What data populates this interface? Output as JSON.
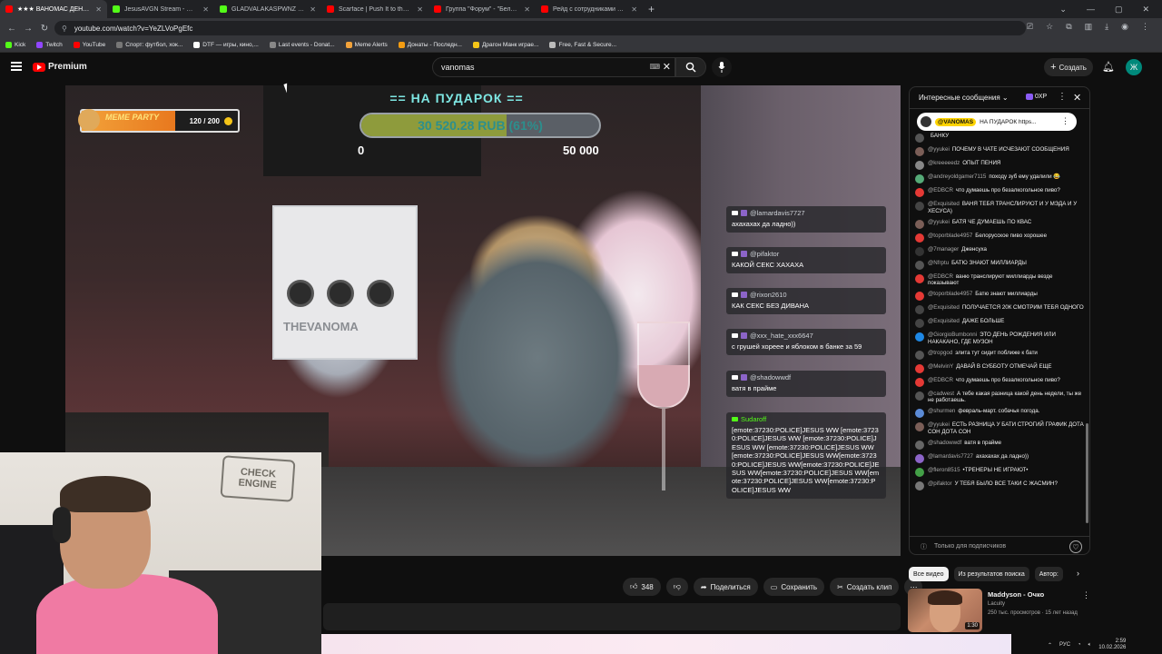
{
  "tabs": [
    {
      "title": "★★★ ВАНОМАС ДЕНЬ РОЖДЕНИЯ",
      "color": "#ff0000",
      "active": true
    },
    {
      "title": "JesusAVGN Stream - Watch Live",
      "color": "#53fc18"
    },
    {
      "title": "GLADVALAKASPWNZ Stream - Watch",
      "color": "#53fc18"
    },
    {
      "title": "Scarface | Push It to the Limit",
      "color": "#ff0000"
    },
    {
      "title": "Группа \"Форум\" - \"Белая ночь\"",
      "color": "#ff0000"
    },
    {
      "title": "Рейд с сотрудниками ППСП",
      "color": "#ff0000"
    }
  ],
  "browser": {
    "url": "youtube.com/watch?v=YeZLVoPgEfc"
  },
  "bookmarks": [
    {
      "label": "Kick",
      "color": "#53fc18"
    },
    {
      "label": "Twitch",
      "color": "#9146ff"
    },
    {
      "label": "YouTube",
      "color": "#ff0000"
    },
    {
      "label": "Спорт: футбол, хок...",
      "color": "#777"
    },
    {
      "label": "DTF — игры, кино,...",
      "color": "#ffffff"
    },
    {
      "label": "Last events - Donat...",
      "color": "#888"
    },
    {
      "label": "Meme Alerts",
      "color": "#f2a23a"
    },
    {
      "label": "Донаты - Последн...",
      "color": "#f39c12"
    },
    {
      "label": "Драгон Манк играе...",
      "color": "#f5c518"
    },
    {
      "label": "Free, Fast & Secure...",
      "color": "#bbb"
    }
  ],
  "yt": {
    "logo": "Premium",
    "search_value": "vanomas",
    "create_label": "Создать",
    "avatar_letter": "Ж"
  },
  "overlay": {
    "goal_title": "== НА ПУДАРОК ==",
    "goal_amount": "30 520.28 RUB (61%)",
    "goal_progress": 0.61,
    "goal_min": "0",
    "goal_max": "50 000",
    "meme_label": "MEME PARTY",
    "meme_count": "120 / 200",
    "meme_progress": 0.6
  },
  "overlay_chat": [
    {
      "user": "@lamardavis7727",
      "msg": "ахахахах да ладно))"
    },
    {
      "user": "@pifaktor",
      "msg": "КАКОЙ СЕКС ХАХАХА"
    },
    {
      "user": "@rixon2610",
      "msg": "КАК СЕКС БЕЗ ДИВАНА"
    },
    {
      "user": "@xxx_hate_xxx6647",
      "msg": "с грушей хорееe и яблоком в банке за 59"
    },
    {
      "user": "@shadowwdf",
      "msg": "ватя в прайме"
    },
    {
      "user": "Sudaroff",
      "msg": "[emote:37230:POLICE]JESUS WW [emote:37230:POLICE]JESUS WW [emote:37230:POLICE]JESUS WW [emote:37230:POLICE]JESUS WW [emote:37230:POLICE]JESUS WW[emote:37230:POLICE]JESUS WW[emote:37230:POLICE]JESUS WW[emote:37230:POLICE]JESUS WW[emote:37230:POLICE]JESUS WW[emote:37230:POLICE]JESUS WW"
    }
  ],
  "webcam": {
    "sign": "CHECK ENGINE"
  },
  "actions": {
    "likes": "348",
    "share": "Поделиться",
    "save": "Сохранить",
    "clip": "Создать клип"
  },
  "chat": {
    "title": "Интересные сообщения",
    "xp": "0XP",
    "pinned_user": "@VANOMAS",
    "pinned_text": "НА ПУДАРОК https...",
    "footer": "Только для подписчиков",
    "messages": [
      {
        "user": "",
        "text": "БАНКУ",
        "color": "#555"
      },
      {
        "user": "@yyukei",
        "text": "ПОЧЕМУ В ЧАТЕ ИСЧЕЗАЮТ СООБЩЕНИЯ",
        "color": "#7b5e57"
      },
      {
        "user": "@kreeeeedz",
        "text": "ОПЫТ ПЕНИЯ",
        "color": "#888"
      },
      {
        "user": "@andreyoldgamer7115",
        "text": "походу зуб ему удалили 😂",
        "color": "#5a7"
      },
      {
        "user": "@EDBCR",
        "text": "что думаешь про безалкогольное пиво?",
        "color": "#e53935"
      },
      {
        "user": "@Exquisited",
        "text": "ВАНЯ ТЕБЯ ТРАНСЛИРУЮТ И У МЭДА И У ХЕСУСА)",
        "color": "#444"
      },
      {
        "user": "@yyukei",
        "text": "БАТЯ ЧЕ ДУМАЕШЬ ПО КВАС",
        "color": "#7b5e57"
      },
      {
        "user": "@toporblade4957",
        "text": "Белорусское пиво хорошее",
        "color": "#e53935"
      },
      {
        "user": "@7manager",
        "text": "Дженсуха",
        "color": "#333"
      },
      {
        "user": "@Nfrptu",
        "text": "БАТЮ ЗНАЮТ МИЛЛИАРДЫ",
        "color": "#555"
      },
      {
        "user": "@EDBCR",
        "text": "ваню транслируют миллиарды везде показывают",
        "color": "#e53935"
      },
      {
        "user": "@toporblade4957",
        "text": "Батю знают миллиарды",
        "color": "#e53935"
      },
      {
        "user": "@Exquisited",
        "text": "ПОЛУЧАЕТСЯ 20К СМОТРИМ ТЕБЯ ОДНОГО",
        "color": "#444"
      },
      {
        "user": "@Exquisited",
        "text": "ДАЖЕ БОЛЬШЕ",
        "color": "#444"
      },
      {
        "user": "@GiorgioBumbonni",
        "text": "ЭТО ДЕНЬ РОЖДЕНИЯ ИЛИ НАКАКАНО, ГДЕ МУЗОН",
        "color": "#1e88e5"
      },
      {
        "user": "@tropgod",
        "text": "элита тут сидит поближе к бати",
        "color": "#555"
      },
      {
        "user": "@MelvinY",
        "text": "ДАВАЙ В СУББОТУ ОТМЕЧАЙ ЕЩЕ",
        "color": "#e53935"
      },
      {
        "user": "@EDBCR",
        "text": "что думаешь про безалкогольное пиво?",
        "color": "#e53935"
      },
      {
        "user": "@cadwest",
        "text": "А тебе какая разница какой день недели, ты же не работаешь.",
        "color": "#555"
      },
      {
        "user": "@shurmen",
        "text": "февраль-март. собачья погода.",
        "color": "#5c8bd6"
      },
      {
        "user": "@yyukei",
        "text": "ЕСТЬ РАЗНИЦА У БАТИ СТРОГИЙ ГРАФИК ДОТА СОН ДОТА СОН",
        "color": "#7b5e57"
      },
      {
        "user": "@shadowwdf",
        "text": "ватя в прайме",
        "color": "#666"
      },
      {
        "user": "@lamardavis7727",
        "text": "ахахахах да ладно))",
        "color": "#8c64c8"
      },
      {
        "user": "@fleron8515",
        "text": "•ТРЕНЕРЫ НЕ ИГРАЮТ•",
        "color": "#43a047"
      },
      {
        "user": "@pifaktor",
        "text": "У ТЕБЯ БЫЛО ВСЕ ТАКИ С ЖАСМИН?",
        "color": "#777"
      }
    ]
  },
  "chips": [
    "Все видео",
    "Из результатов поиска",
    "Автор: "
  ],
  "related": {
    "title": "Maddyson - Очко",
    "channel": "Lacuity",
    "meta": "250 тыс. просмотров · 15 лет назад",
    "duration": "1:30"
  },
  "tray": {
    "lang": "РУС",
    "time": "2:59",
    "date": "10.02.2026"
  }
}
